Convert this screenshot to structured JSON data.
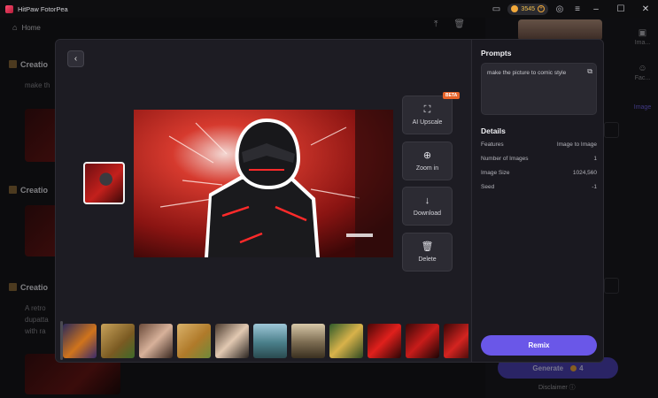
{
  "app": {
    "title": "HitPaw FotorPea"
  },
  "titlebar": {
    "credits": "3545"
  },
  "background": {
    "home_label": "Home",
    "sections": [
      {
        "title": "Creatio",
        "text": "make th"
      },
      {
        "title": "Creatio",
        "text": ""
      },
      {
        "title": "Creatio",
        "text_lines": [
          "A retro",
          "dupatta",
          "with ra"
        ]
      }
    ],
    "side_tabs": [
      {
        "label": "Ima..."
      },
      {
        "label": "Fac..."
      },
      {
        "label": "Image"
      }
    ],
    "generate": {
      "label": "Generate",
      "cost": "4"
    },
    "disclaimer": "Disclaimer"
  },
  "modal": {
    "tools": [
      {
        "icon": "ai-upscale-icon",
        "label": "AI Upscale",
        "badge": "BETA"
      },
      {
        "icon": "zoom-in-icon",
        "label": "Zoom in"
      },
      {
        "icon": "download-icon",
        "label": "Download"
      },
      {
        "icon": "delete-icon",
        "label": "Delete"
      }
    ],
    "prompts_title": "Prompts",
    "prompt_text": "make the picture to comic style",
    "details_title": "Details",
    "details": [
      {
        "label": "Features",
        "value": "Image to Image"
      },
      {
        "label": "Number of Images",
        "value": "1"
      },
      {
        "label": "Image Size",
        "value": "1024,560"
      },
      {
        "label": "Seed",
        "value": "-1"
      }
    ],
    "remix_label": "Remix"
  },
  "colors": {
    "accent": "#6a57e8",
    "beta": "#e7642a",
    "coin": "#f2a93b"
  }
}
